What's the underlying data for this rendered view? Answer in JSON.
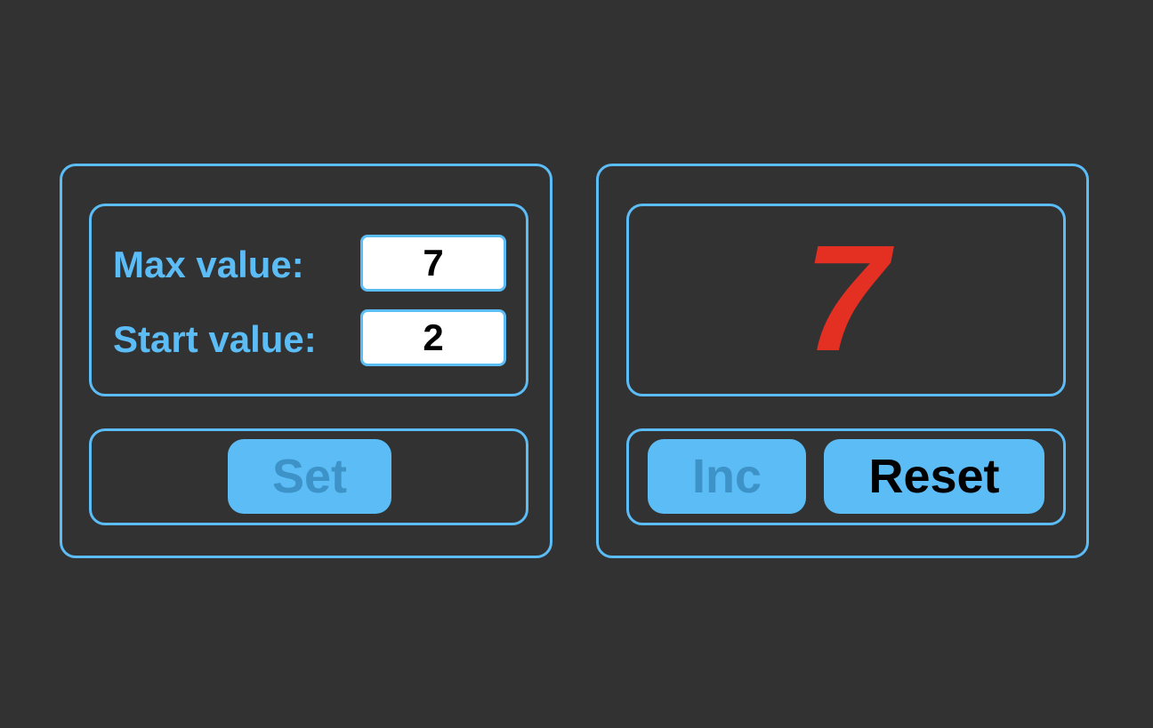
{
  "settings": {
    "max_label": "Max value:",
    "max_value": "7",
    "start_label": "Start value:",
    "start_value": "2",
    "set_label": "Set"
  },
  "counter": {
    "value": "7",
    "inc_label": "Inc",
    "reset_label": "Reset"
  },
  "colors": {
    "background": "#323232",
    "accent": "#5bbcf6",
    "counter_max_value": "#e43022",
    "disabled_text": "#3d92c7"
  }
}
